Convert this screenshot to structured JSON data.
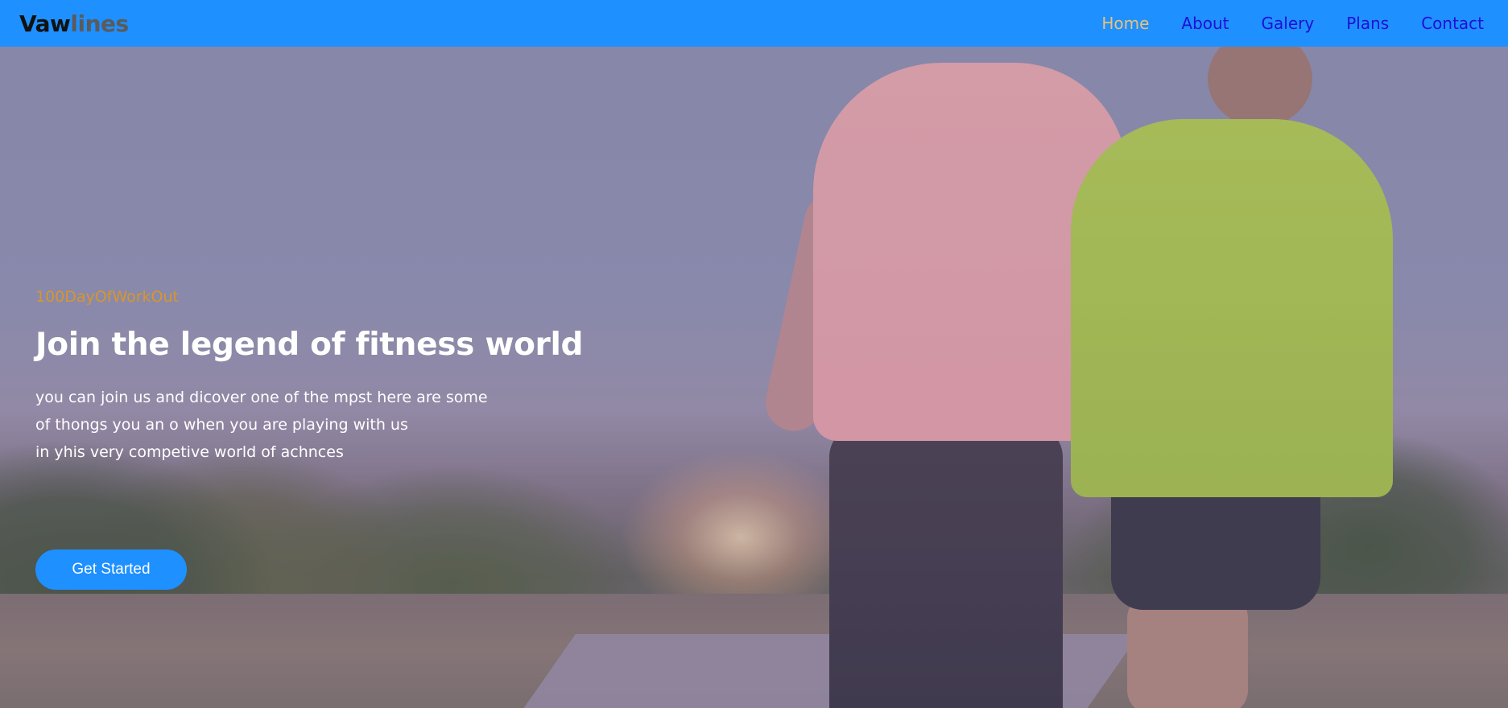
{
  "nav": {
    "logo_part1": "Vaw",
    "logo_part2": "lines",
    "links": [
      "Home",
      "About",
      "Galery",
      "Plans",
      "Contact"
    ],
    "active": "Home"
  },
  "hero": {
    "tagline": "100DayOfWorkOut",
    "headline": "Join the legend of fitness world",
    "description_lines": [
      "you can join us and dicover one of the mpst here are some",
      "of thongs you an o when you are playing with us",
      "in yhis very competive world of achnces"
    ],
    "cta_label": "Get Started"
  },
  "colors": {
    "navbar_bg": "#1e90ff",
    "nav_link": "#1f0fd6",
    "nav_active": "#e8c27a",
    "tagline": "#d8962a",
    "cta_bg": "#1e90ff"
  }
}
